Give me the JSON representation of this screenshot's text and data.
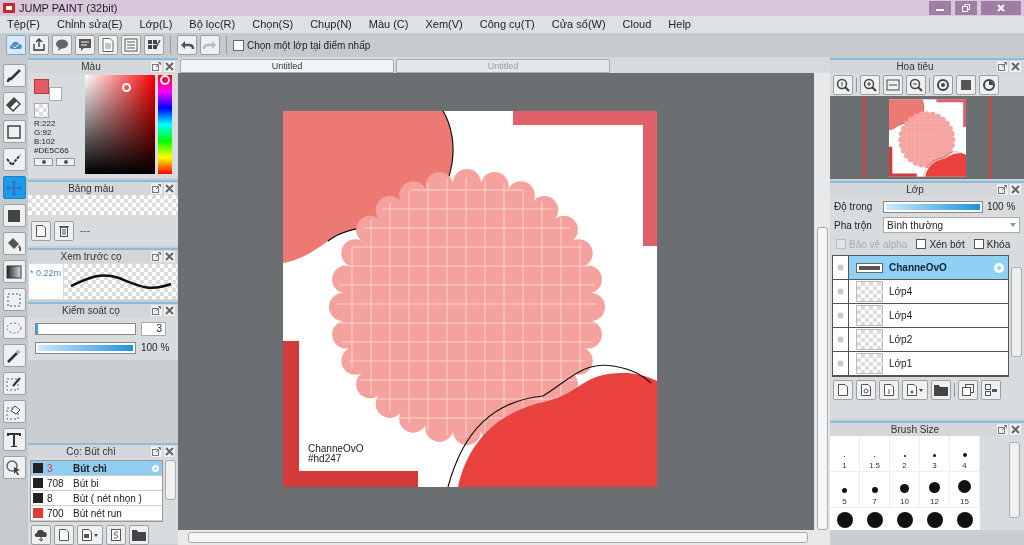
{
  "window": {
    "title": "JUMP PAINT (32bit)"
  },
  "menu": [
    "Tệp(F)",
    "Chỉnh sửa(E)",
    "Lớp(L)",
    "Bộ lọc(R)",
    "Chọn(S)",
    "Chụp(N)",
    "Màu (C)",
    "Xem(V)",
    "Công cụ(T)",
    "Cửa sổ(W)",
    "Cloud",
    "Help"
  ],
  "toolbar": {
    "pick_layer": {
      "label": "Chọn một lớp tại điểm nhấp",
      "checked": false
    }
  },
  "tools": [
    {
      "kind": "brush",
      "selected": false
    },
    {
      "kind": "eraser",
      "selected": false
    },
    {
      "kind": "rect",
      "selected": false
    },
    {
      "kind": "polyline",
      "selected": false
    },
    {
      "kind": "move",
      "selected": true
    },
    {
      "kind": "fill",
      "selected": false
    },
    {
      "kind": "bucket",
      "selected": false
    },
    {
      "kind": "gradient",
      "selected": false
    },
    {
      "kind": "select-rect",
      "selected": false
    },
    {
      "kind": "lasso",
      "selected": false
    },
    {
      "kind": "wand",
      "selected": false
    },
    {
      "kind": "select-pen",
      "selected": false
    },
    {
      "kind": "select-eraser",
      "selected": false
    },
    {
      "kind": "text",
      "selected": false
    },
    {
      "kind": "pointer",
      "selected": false
    }
  ],
  "tabs": [
    {
      "label": "Untitled",
      "selected": true
    },
    {
      "label": "Untitled",
      "selected": false
    }
  ],
  "color_panel": {
    "title": "Màu",
    "color": "#de5c66",
    "r": "R:222",
    "g": "G:92",
    "b": "B:102",
    "hex": "#DE5C66"
  },
  "palette_panel": {
    "title": "Bảng màu",
    "label": "---"
  },
  "brush_preview": {
    "title": "Xem trước cọ",
    "size": "* 0.22m"
  },
  "brush_control": {
    "title": "Kiểm soát cọ",
    "size": {
      "level": 0.02,
      "value": "3"
    },
    "opacity": {
      "level": 1,
      "reading": "100 %"
    }
  },
  "brush_list": {
    "title": "Cọ: Bút chì",
    "items": [
      {
        "size": "3",
        "name": "Bút chì",
        "color": "#222222",
        "selected": true
      },
      {
        "size": "708",
        "name": "Bút bi",
        "color": "#222222",
        "selected": false
      },
      {
        "size": "8",
        "name": "Bút ( nét nhọn )",
        "color": "#222222",
        "selected": false
      },
      {
        "size": "700",
        "name": "Bút nét run",
        "color": "#e53935",
        "selected": false
      }
    ]
  },
  "canvas": {
    "signature": [
      "ChanneOvO",
      "#hd247"
    ]
  },
  "navigator": {
    "title": "Hoa tiêu"
  },
  "layer_panel": {
    "title": "Lớp",
    "opacity_label": "Độ trong",
    "opacity": {
      "level": 1,
      "reading": "100 %"
    },
    "blend_label": "Pha trộn",
    "blend": "Bình thường",
    "options": [
      {
        "label": "Bảo vệ alpha",
        "checked": false,
        "disabled": true
      },
      {
        "label": "Xén bớt",
        "checked": false,
        "disabled": false
      },
      {
        "label": "Khóa",
        "checked": false,
        "disabled": false
      }
    ],
    "layers": [
      {
        "name": "ChanneOvO",
        "kind": "text",
        "selected": true
      },
      {
        "name": "Lớp4",
        "kind": "raster",
        "selected": false
      },
      {
        "name": "Lớp4",
        "kind": "raster",
        "selected": false
      },
      {
        "name": "Lớp2",
        "kind": "raster",
        "selected": false
      },
      {
        "name": "Lớp1",
        "kind": "raster",
        "selected": false
      }
    ]
  },
  "brush_size": {
    "title": "Brush Size",
    "sizes": [
      "1",
      "1.5",
      "2",
      "3",
      "4",
      "5",
      "7",
      "10",
      "12",
      "15"
    ]
  }
}
